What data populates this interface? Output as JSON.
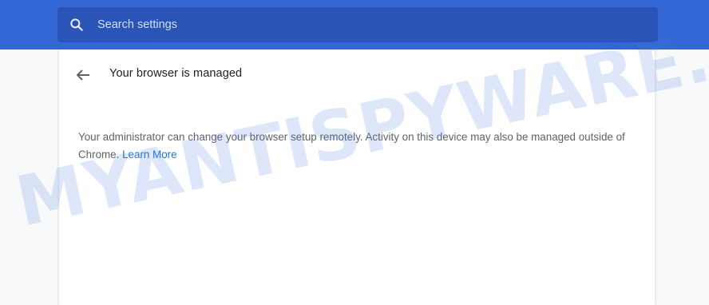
{
  "search": {
    "placeholder": "Search settings",
    "icon": "search-icon"
  },
  "colors": {
    "topbar": "#3367d6",
    "search_box": "#2a54b8",
    "link": "#1a73e8",
    "title_text": "#202124",
    "body_text": "#5f6368"
  },
  "page": {
    "back_icon": "arrow-back-icon",
    "title": "Your browser is managed",
    "message": "Your administrator can change your browser setup remotely. Activity on this device may also be managed outside of Chrome.",
    "link_label": "Learn More"
  },
  "watermark": {
    "text": "MYANTISPYWARE.COM"
  }
}
